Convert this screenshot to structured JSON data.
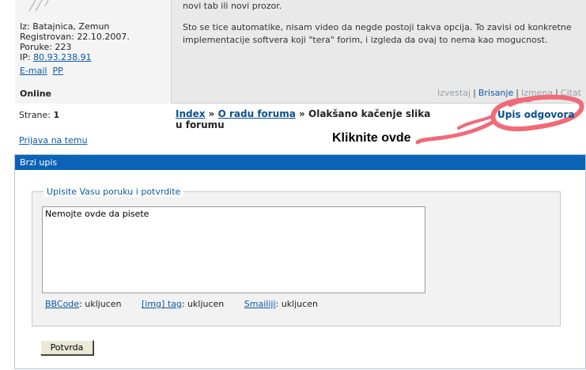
{
  "post": {
    "user": {
      "location": "Iz: Batajnica, Zemun",
      "registered": "Registrovan: 22.10.2007.",
      "posts": "Poruke: 223",
      "ip_label": "IP: ",
      "ip_value": "80.93.238.91",
      "email_link": "E-mail",
      "pp_link": "PP",
      "status": "Online"
    },
    "message": {
      "line1": "novi tab ili novi prozor.",
      "paragraph": "Sto se tice automatike, nisam video da negde postoji takva opcija. To zavisi od konkretne implementacije softvera koji \"tera\" forim, i izgleda da ovaj to nema kao mogucnost."
    },
    "actions": {
      "report": "Izvestaj",
      "delete": "Brisanje",
      "edit": "Izmena",
      "quote": "Citat",
      "separator": "|"
    }
  },
  "nav": {
    "pages_label": "Strane:",
    "pages_value": "1",
    "breadcrumb_index": "Index",
    "breadcrumb_sep": "»",
    "breadcrumb_forum": "O radu foruma",
    "breadcrumb_topic": "Olakšano kačenje slika u forumu",
    "reply_link": "Upis odgovora",
    "annotation": "Kliknite ovde",
    "report_topic": "Prijava na temu"
  },
  "quick_reply": {
    "title": "Brzi upis",
    "legend": "Upisite Vasu poruku i potvrdite",
    "textarea_value": "Nemojte ovde da pisete",
    "options": [
      {
        "link": "BBCode",
        "status": ": ukljucen"
      },
      {
        "link": "[img] tag",
        "status": ": ukljucen"
      },
      {
        "link": "Smailiji",
        "status": ": ukljucen"
      }
    ],
    "submit_label": "Potvrda"
  },
  "colors": {
    "header_bar": "#0b63b7",
    "link": "#0b5aa6",
    "annotation_circle": "#f06a78"
  }
}
